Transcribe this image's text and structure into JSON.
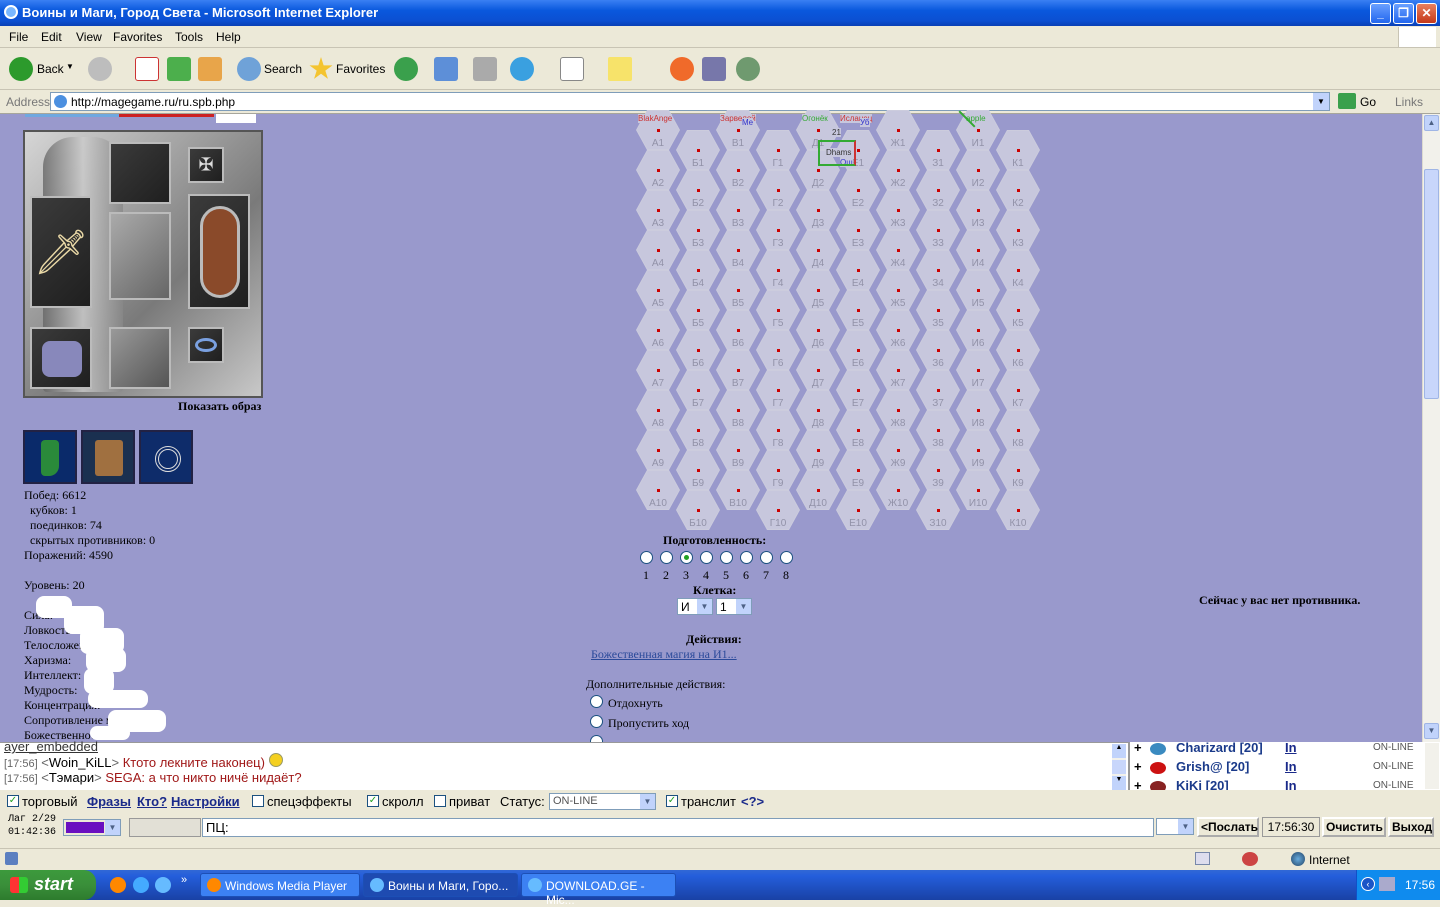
{
  "window": {
    "title": "Воины и Маги, Город Света - Microsoft Internet Explorer"
  },
  "menu": [
    "File",
    "Edit",
    "View",
    "Favorites",
    "Tools",
    "Help"
  ],
  "toolbar": {
    "back": "Back",
    "search": "Search",
    "favorites": "Favorites"
  },
  "address": {
    "label": "Address",
    "url": "http://magegame.ru/ru.spb.php",
    "go": "Go",
    "links": "Links"
  },
  "character": {
    "show_image": "Показать образ",
    "stats": [
      "Побед: 6612",
      "кубков: 1",
      "поединков: 74",
      "скрытых противников: 0",
      "Поражений: 4590",
      "Уровень: 20"
    ],
    "attrs": [
      "Сила:",
      "Ловкость:",
      "Телосложение:",
      "Харизма:",
      "Интеллект:",
      "Мудрость:",
      "Концентрация:",
      "Сопротивление магии:",
      "Божественность:"
    ]
  },
  "board": {
    "cols": [
      "А",
      "Б",
      "В",
      "Г",
      "Д",
      "Е",
      "Ж",
      "З",
      "И",
      "К"
    ],
    "top_labels": [
      "BlakAnge",
      "Зарвелой",
      "Мe",
      "Огонёк",
      "Исланец",
      "Уб",
      "apple",
      "21",
      "Dhams",
      "Ош"
    ]
  },
  "controls": {
    "readiness_label": "Подготовленность:",
    "readiness": [
      "1",
      "2",
      "3",
      "4",
      "5",
      "6",
      "7",
      "8"
    ],
    "readiness_selected": 3,
    "cell_label": "Клетка:",
    "cell_letter": "И",
    "cell_number": "1",
    "actions_label": "Действия:",
    "action_link": "Божественная магия на И1...",
    "extra_label": "Дополнительные действия:",
    "extra_options": [
      "Отдохнуть",
      "Пропустить ход",
      "С..."
    ],
    "no_opponent": "Сейчас у вас нет противника."
  },
  "chat": {
    "messages": [
      {
        "time": "[17:56]",
        "nick": "Woin_KiLL",
        "text": "Ктото лекните наконец)"
      },
      {
        "time": "[17:56]",
        "nick": "Тэмари",
        "text": "SEGA: а что никто ничё нидаёт?"
      }
    ],
    "top_partial": "ayer_embedded"
  },
  "online": [
    {
      "name": "Charizard [20]",
      "link": "In",
      "status": "ON-LINE"
    },
    {
      "name": "Grish@ [20]",
      "link": "In",
      "status": "ON-LINE"
    },
    {
      "name": "KiKi [20]",
      "link": "In",
      "status": "ON-LINE"
    }
  ],
  "chatbar": {
    "trade": "торговый",
    "phrases": "Фразы",
    "who": "Кто?",
    "settings": "Настройки",
    "effects": "спецэффекты",
    "scroll": "скролл",
    "private": "приват",
    "status_label": "Статус:",
    "status_value": "ON-LINE",
    "translit": "транслит",
    "translit_help": "<?>"
  },
  "inputbar": {
    "lag": "Лаг 2/29",
    "clock": "01:42:36",
    "prefix": "ПЦ:",
    "send": "<Послать",
    "time": "17:56:30",
    "clear": "Очистить",
    "exit": "Выход"
  },
  "statusbar": {
    "zone": "Internet"
  },
  "taskbar": {
    "start": "start",
    "tasks": [
      "Windows Media Player",
      "Воины и Маги, Горо...",
      "DOWNLOAD.GE - Mic..."
    ],
    "clock": "17:56"
  }
}
